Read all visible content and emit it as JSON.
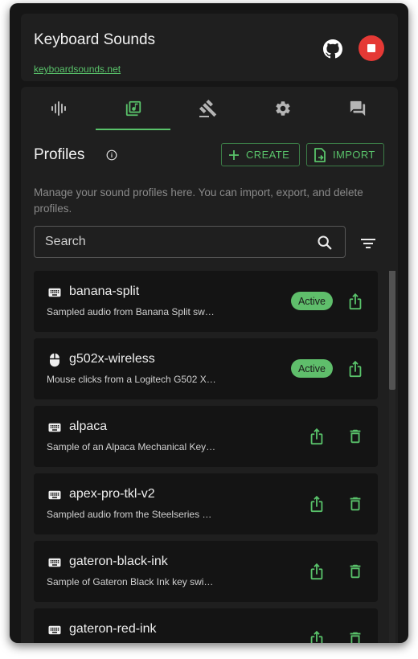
{
  "app": {
    "title": "Keyboard Sounds",
    "link": "keyboardsounds.net",
    "colors": {
      "accent": "#59c26a",
      "stop": "#e53935",
      "background": "#161616",
      "card": "#1f1f1f"
    }
  },
  "header_icons": [
    "github-icon",
    "stop-icon"
  ],
  "tabs": [
    {
      "icon": "waveform-icon",
      "active": false
    },
    {
      "icon": "music-library-icon",
      "active": true
    },
    {
      "icon": "gavel-icon",
      "active": false
    },
    {
      "icon": "gear-icon",
      "active": false
    },
    {
      "icon": "chat-icon",
      "active": false
    }
  ],
  "profiles_section": {
    "title": "Profiles",
    "create_label": "CREATE",
    "import_label": "IMPORT",
    "description": "Manage your sound profiles here. You can import, export, and delete profiles.",
    "search_placeholder": "Search"
  },
  "profiles": [
    {
      "name": "banana-split",
      "description": "Sampled audio from Banana Split sw…",
      "device": "keyboard-icon",
      "status": "Active",
      "deletable": false
    },
    {
      "name": "g502x-wireless",
      "description": "Mouse clicks from a Logitech G502 X…",
      "device": "mouse-icon",
      "status": "Active",
      "deletable": false
    },
    {
      "name": "alpaca",
      "description": "Sample of an Alpaca Mechanical Key…",
      "device": "keyboard-icon",
      "status": "",
      "deletable": true
    },
    {
      "name": "apex-pro-tkl-v2",
      "description": "Sampled audio from the Steelseries …",
      "device": "keyboard-icon",
      "status": "",
      "deletable": true
    },
    {
      "name": "gateron-black-ink",
      "description": "Sample of Gateron Black Ink key swi…",
      "device": "keyboard-icon",
      "status": "",
      "deletable": true
    },
    {
      "name": "gateron-red-ink",
      "description": "",
      "device": "keyboard-icon",
      "status": "",
      "deletable": true
    }
  ]
}
